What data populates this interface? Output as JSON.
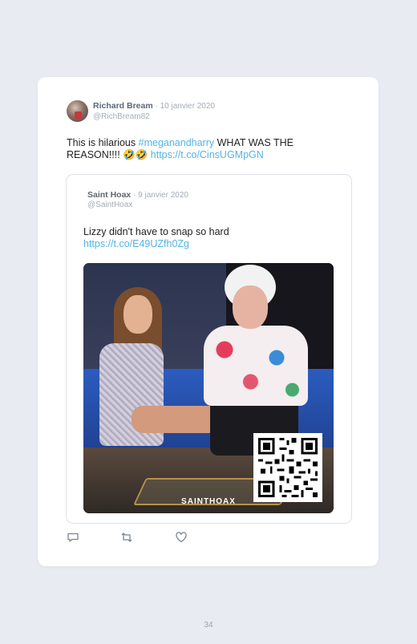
{
  "tweet": {
    "author_name": "Richard Bream",
    "date": " · 10 janvier 2020",
    "handle": "@RichBream82",
    "text_plain": "This is hilarious ",
    "hashtag": "#meganandharry",
    "text_after_hashtag": " WHAT WAS THE REASON!!!! 🤣🤣 ",
    "link": "https://t.co/CinsUGMpGN"
  },
  "quoted_tweet": {
    "author_name": "Saint Hoax",
    "date": " · 9 janvier 2020",
    "handle": "@SaintHoax",
    "text": "Lizzy didn't have to snap so hard",
    "link": "https://t.co/E49UZfh0Zg",
    "media_watermark": "SAINTHOAX"
  },
  "actions": {
    "reply_icon": "reply-icon",
    "retweet_icon": "retweet-icon",
    "like_icon": "heart-icon"
  },
  "page_number": "34",
  "colors": {
    "background": "#e8ebf2",
    "card": "#ffffff",
    "link": "#52b4e6",
    "muted": "#a3acb8"
  }
}
